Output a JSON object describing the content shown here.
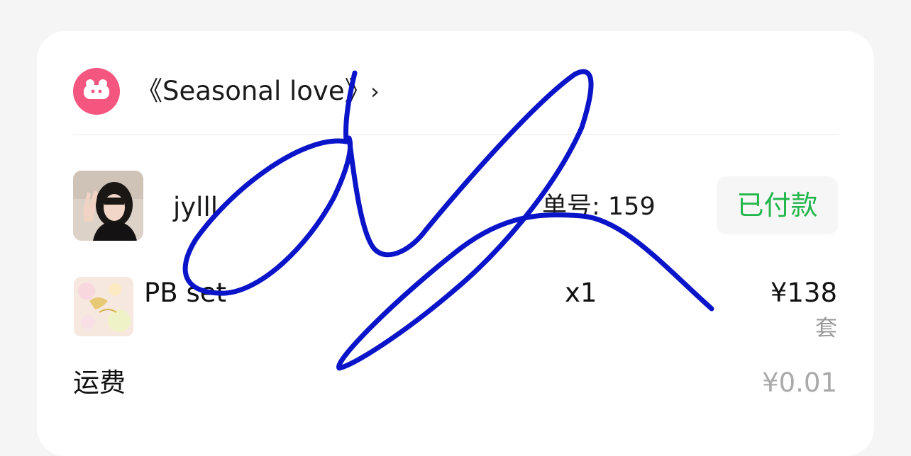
{
  "shop": {
    "name": "《Seasonal love》",
    "chevron": "›",
    "logo_icon": "shop-logo-icon",
    "accent_color": "#f4567f"
  },
  "order": {
    "buyer_name": "jylll",
    "order_number": "单号: 159",
    "status": "已付款",
    "status_color": "#22b64b"
  },
  "product": {
    "name": "PB set",
    "quantity": "x1",
    "price": "¥138",
    "unit": "套"
  },
  "shipping": {
    "label": "运费",
    "fee": "¥0.01"
  },
  "annotation": {
    "type": "handwritten-signature",
    "color": "#0a14c8"
  }
}
